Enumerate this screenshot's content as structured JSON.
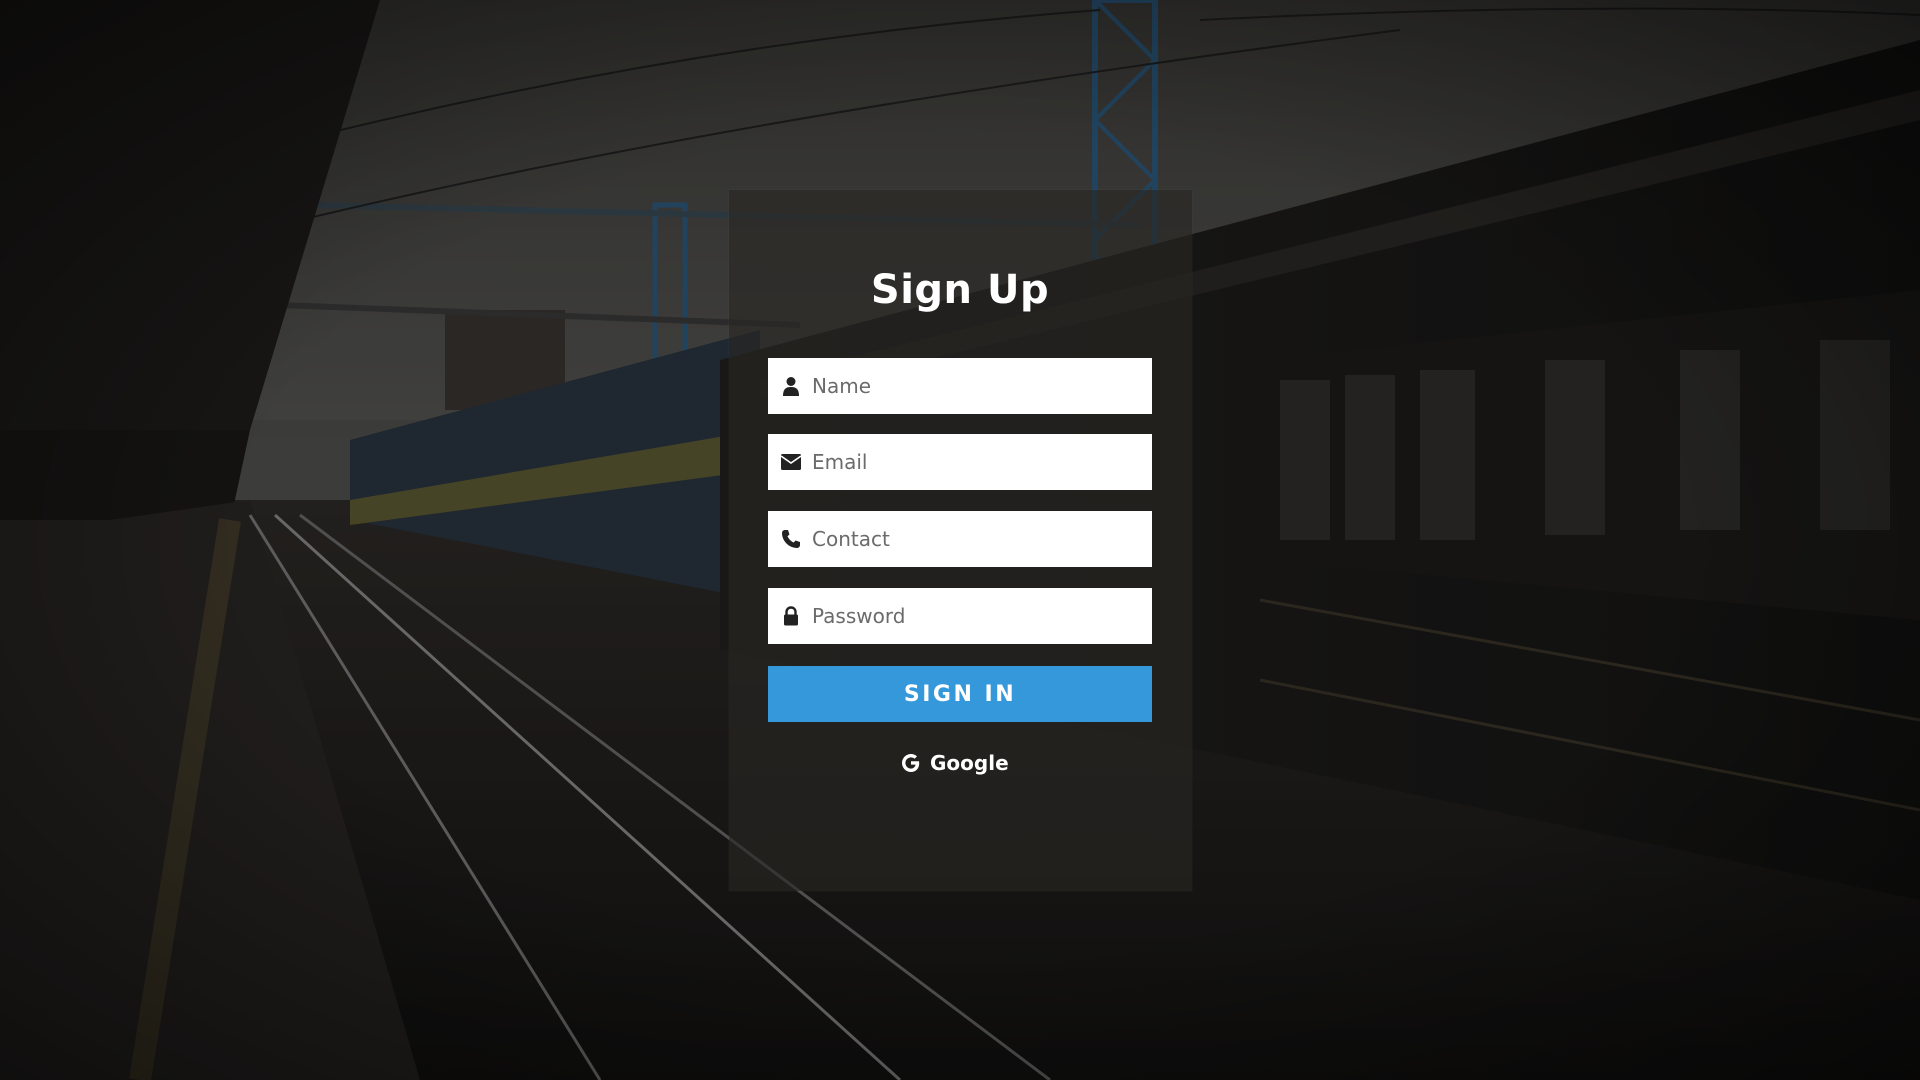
{
  "form": {
    "title": "Sign Up",
    "fields": [
      {
        "icon": "user-icon",
        "placeholder": "Name",
        "value": ""
      },
      {
        "icon": "envelope-icon",
        "placeholder": "Email",
        "value": ""
      },
      {
        "icon": "phone-icon",
        "placeholder": "Contact",
        "value": ""
      },
      {
        "icon": "lock-icon",
        "placeholder": "Password",
        "value": ""
      }
    ],
    "submit_label": "SIGN IN",
    "google_label": "Google"
  },
  "colors": {
    "accent": "#3498db",
    "overlay": "#1a1917",
    "field_bg": "#ffffff",
    "text_light": "#ffffff"
  }
}
